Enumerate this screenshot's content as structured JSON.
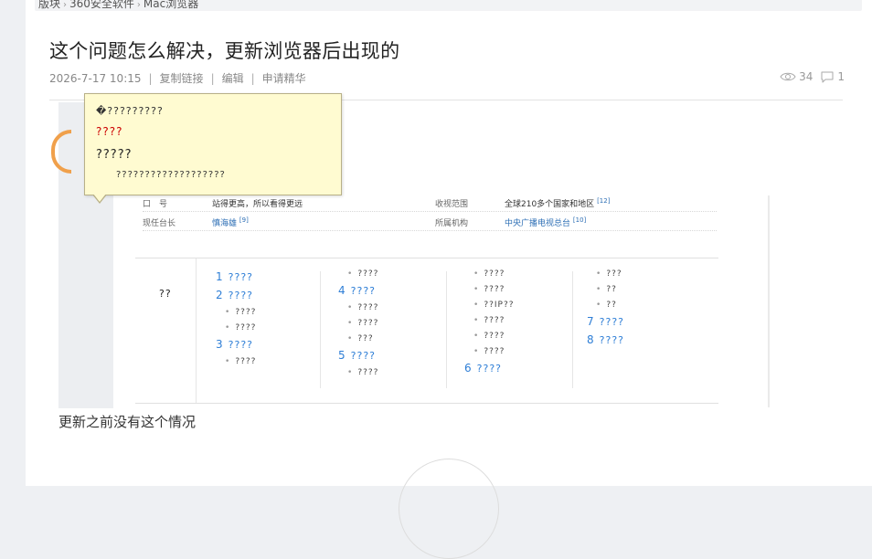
{
  "breadcrumb": {
    "items": [
      "版块",
      "360安全软件",
      "Mac浏览器"
    ],
    "separator": "›"
  },
  "post": {
    "title": "这个问题怎么解决，更新浏览器后出现的",
    "date": "2026-7-17 10:15",
    "actions": [
      "复制链接",
      "编辑",
      "申请精华"
    ],
    "views": "34",
    "comments": "1",
    "body": "更新之前没有这个情况"
  },
  "screenshot": {
    "tooltip": {
      "line1": "�?????????",
      "line2": "????",
      "line3": "?????",
      "line4": "???????????????????"
    },
    "info_rows": [
      {
        "k": "口　号",
        "v": "站得更高，所以看得更远",
        "k2": "收视范围",
        "v2": "全球210多个国家和地区",
        "ref2": "[12]"
      },
      {
        "k": "现任台长",
        "v": "慎海雄",
        "ref": "[9]",
        "k2": "所属机构",
        "v2": "中央广播电视总台",
        "ref2b": "[10]"
      }
    ],
    "toc_head": "??",
    "toc_col1": [
      {
        "type": "item",
        "num": "1",
        "label": "????"
      },
      {
        "type": "item",
        "num": "2",
        "label": "????"
      },
      {
        "type": "sub",
        "label": "????"
      },
      {
        "type": "sub",
        "label": "????"
      },
      {
        "type": "item",
        "num": "3",
        "label": "????"
      },
      {
        "type": "sub",
        "label": "????"
      }
    ],
    "toc_col2": [
      {
        "type": "sub",
        "label": "????"
      },
      {
        "type": "item",
        "num": "4",
        "label": "????"
      },
      {
        "type": "sub",
        "label": "????"
      },
      {
        "type": "sub",
        "label": "????"
      },
      {
        "type": "sub",
        "label": "???"
      },
      {
        "type": "item",
        "num": "5",
        "label": "????"
      },
      {
        "type": "sub",
        "label": "????"
      }
    ],
    "toc_col3": [
      {
        "type": "sub",
        "label": "????"
      },
      {
        "type": "sub",
        "label": "????"
      },
      {
        "type": "sub",
        "label": "??IP??"
      },
      {
        "type": "sub",
        "label": "????"
      },
      {
        "type": "sub",
        "label": "????"
      },
      {
        "type": "sub",
        "label": "????"
      },
      {
        "type": "item",
        "num": "6",
        "label": "????"
      }
    ],
    "toc_col4": [
      {
        "type": "sub",
        "label": "???"
      },
      {
        "type": "sub",
        "label": "??"
      },
      {
        "type": "sub",
        "label": "??"
      },
      {
        "type": "item",
        "num": "7",
        "label": "????"
      },
      {
        "type": "item",
        "num": "8",
        "label": "????"
      }
    ]
  },
  "colors": {
    "link_blue": "#2e7ed6",
    "tooltip_bg": "#fffbd1",
    "ring_orange": "#f0a04b"
  }
}
